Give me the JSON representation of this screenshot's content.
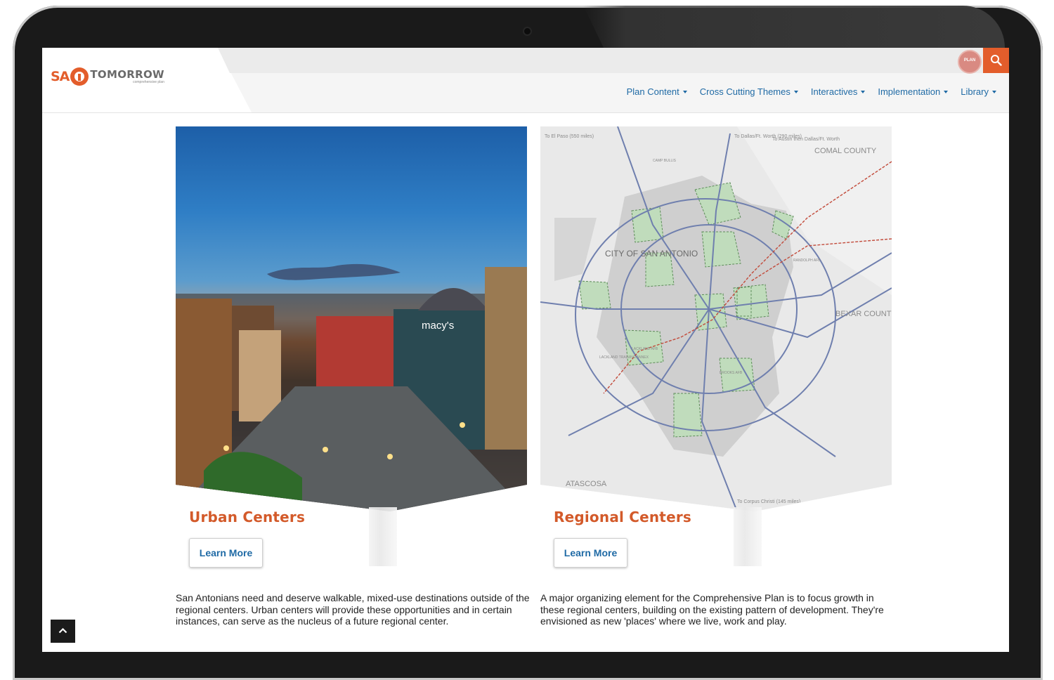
{
  "header": {
    "logo": {
      "mark_text": "SA",
      "word": "TOMORROW",
      "tagline": "comprehensive plan"
    },
    "plan_badge_text": "PLAN",
    "search_icon": "search-icon",
    "nav": [
      {
        "label": "Plan Content"
      },
      {
        "label": "Cross Cutting Themes"
      },
      {
        "label": "Interactives"
      },
      {
        "label": "Implementation"
      },
      {
        "label": "Library"
      }
    ]
  },
  "cards": [
    {
      "title": "Urban Centers",
      "button": "Learn More",
      "description": "San Antonians need and deserve walkable, mixed-use destinations outside of the regional centers. Urban centers will provide these opportunities and in certain instances, can serve as the nucleus of a future regional center.",
      "image": {
        "storefront_sign": "macy's"
      }
    },
    {
      "title": "Regional Centers",
      "button": "Learn More",
      "description": "A major organizing element for the Comprehensive Plan is to focus growth in these regional centers, building on the existing pattern of development. They're envisioned as new 'places' where we live, work and play.",
      "map": {
        "labels": {
          "el_paso": "To El Paso (550 miles)",
          "dallas": "To Dallas/Ft. Worth (290 miles)",
          "austin": "To Austin then Dallas/Ft. Worth",
          "comal": "COMAL COUNTY",
          "city": "CITY OF SAN ANTONIO",
          "bexar": "BEXAR COUNTY",
          "atascosa": "ATASCOSA",
          "corpus": "To Corpus Christi (145 miles)",
          "camp_bullis": "CAMP BULLIS",
          "randolph": "RANDOLPH AFB",
          "lackland": "LACKLAND AFB",
          "lackland_annex": "LACKLAND TRAINING ANNEX",
          "brooks": "BROOKS AFB"
        }
      }
    }
  ],
  "colors": {
    "accent": "#e35d2b",
    "title": "#d35a2a",
    "link": "#1f6aa5"
  }
}
